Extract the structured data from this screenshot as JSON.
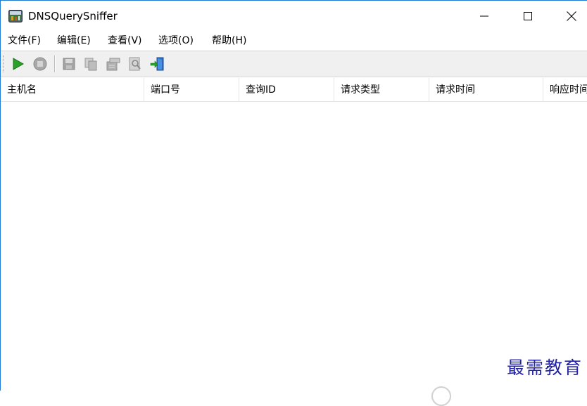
{
  "window": {
    "title": "DNSQuerySniffer",
    "controls": {
      "minimize": "—",
      "maximize": "☐",
      "close": "✕"
    }
  },
  "menu": {
    "items": [
      {
        "label": "文件(F)"
      },
      {
        "label": "编辑(E)"
      },
      {
        "label": "查看(V)"
      },
      {
        "label": "选项(O)"
      },
      {
        "label": "帮助(H)"
      }
    ]
  },
  "toolbar": {
    "buttons": [
      {
        "icon": "play-icon",
        "enabled": true
      },
      {
        "icon": "stop-icon",
        "enabled": false
      },
      {
        "icon": "save-icon",
        "enabled": false
      },
      {
        "icon": "copy-icon",
        "enabled": false
      },
      {
        "icon": "properties-icon",
        "enabled": false
      },
      {
        "icon": "find-icon",
        "enabled": false
      },
      {
        "icon": "exit-icon",
        "enabled": true
      }
    ]
  },
  "table": {
    "columns": [
      {
        "label": "主机名"
      },
      {
        "label": "端口号"
      },
      {
        "label": "查询ID"
      },
      {
        "label": "请求类型"
      },
      {
        "label": "请求时间"
      },
      {
        "label": "响应时间"
      }
    ],
    "rows": []
  },
  "watermark": {
    "text": "最需教育"
  },
  "colors": {
    "play": "#2aa12a",
    "disabled": "#9a9a9a",
    "accent": "#1e7bd6",
    "watermark": "#2323a8"
  }
}
